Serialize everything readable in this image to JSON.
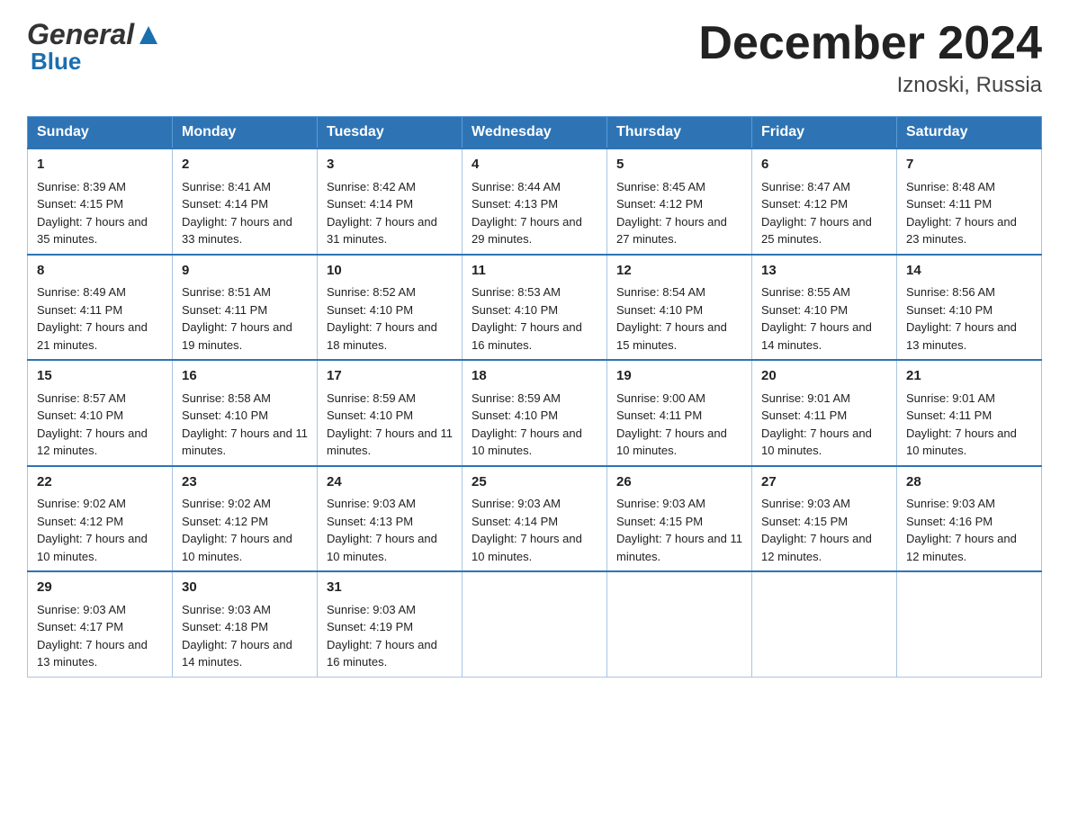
{
  "header": {
    "logo_general": "General",
    "logo_blue": "Blue",
    "title": "December 2024",
    "subtitle": "Iznoski, Russia"
  },
  "days_of_week": [
    "Sunday",
    "Monday",
    "Tuesday",
    "Wednesday",
    "Thursday",
    "Friday",
    "Saturday"
  ],
  "weeks": [
    [
      {
        "day": "1",
        "sunrise": "Sunrise: 8:39 AM",
        "sunset": "Sunset: 4:15 PM",
        "daylight": "Daylight: 7 hours and 35 minutes."
      },
      {
        "day": "2",
        "sunrise": "Sunrise: 8:41 AM",
        "sunset": "Sunset: 4:14 PM",
        "daylight": "Daylight: 7 hours and 33 minutes."
      },
      {
        "day": "3",
        "sunrise": "Sunrise: 8:42 AM",
        "sunset": "Sunset: 4:14 PM",
        "daylight": "Daylight: 7 hours and 31 minutes."
      },
      {
        "day": "4",
        "sunrise": "Sunrise: 8:44 AM",
        "sunset": "Sunset: 4:13 PM",
        "daylight": "Daylight: 7 hours and 29 minutes."
      },
      {
        "day": "5",
        "sunrise": "Sunrise: 8:45 AM",
        "sunset": "Sunset: 4:12 PM",
        "daylight": "Daylight: 7 hours and 27 minutes."
      },
      {
        "day": "6",
        "sunrise": "Sunrise: 8:47 AM",
        "sunset": "Sunset: 4:12 PM",
        "daylight": "Daylight: 7 hours and 25 minutes."
      },
      {
        "day": "7",
        "sunrise": "Sunrise: 8:48 AM",
        "sunset": "Sunset: 4:11 PM",
        "daylight": "Daylight: 7 hours and 23 minutes."
      }
    ],
    [
      {
        "day": "8",
        "sunrise": "Sunrise: 8:49 AM",
        "sunset": "Sunset: 4:11 PM",
        "daylight": "Daylight: 7 hours and 21 minutes."
      },
      {
        "day": "9",
        "sunrise": "Sunrise: 8:51 AM",
        "sunset": "Sunset: 4:11 PM",
        "daylight": "Daylight: 7 hours and 19 minutes."
      },
      {
        "day": "10",
        "sunrise": "Sunrise: 8:52 AM",
        "sunset": "Sunset: 4:10 PM",
        "daylight": "Daylight: 7 hours and 18 minutes."
      },
      {
        "day": "11",
        "sunrise": "Sunrise: 8:53 AM",
        "sunset": "Sunset: 4:10 PM",
        "daylight": "Daylight: 7 hours and 16 minutes."
      },
      {
        "day": "12",
        "sunrise": "Sunrise: 8:54 AM",
        "sunset": "Sunset: 4:10 PM",
        "daylight": "Daylight: 7 hours and 15 minutes."
      },
      {
        "day": "13",
        "sunrise": "Sunrise: 8:55 AM",
        "sunset": "Sunset: 4:10 PM",
        "daylight": "Daylight: 7 hours and 14 minutes."
      },
      {
        "day": "14",
        "sunrise": "Sunrise: 8:56 AM",
        "sunset": "Sunset: 4:10 PM",
        "daylight": "Daylight: 7 hours and 13 minutes."
      }
    ],
    [
      {
        "day": "15",
        "sunrise": "Sunrise: 8:57 AM",
        "sunset": "Sunset: 4:10 PM",
        "daylight": "Daylight: 7 hours and 12 minutes."
      },
      {
        "day": "16",
        "sunrise": "Sunrise: 8:58 AM",
        "sunset": "Sunset: 4:10 PM",
        "daylight": "Daylight: 7 hours and 11 minutes."
      },
      {
        "day": "17",
        "sunrise": "Sunrise: 8:59 AM",
        "sunset": "Sunset: 4:10 PM",
        "daylight": "Daylight: 7 hours and 11 minutes."
      },
      {
        "day": "18",
        "sunrise": "Sunrise: 8:59 AM",
        "sunset": "Sunset: 4:10 PM",
        "daylight": "Daylight: 7 hours and 10 minutes."
      },
      {
        "day": "19",
        "sunrise": "Sunrise: 9:00 AM",
        "sunset": "Sunset: 4:11 PM",
        "daylight": "Daylight: 7 hours and 10 minutes."
      },
      {
        "day": "20",
        "sunrise": "Sunrise: 9:01 AM",
        "sunset": "Sunset: 4:11 PM",
        "daylight": "Daylight: 7 hours and 10 minutes."
      },
      {
        "day": "21",
        "sunrise": "Sunrise: 9:01 AM",
        "sunset": "Sunset: 4:11 PM",
        "daylight": "Daylight: 7 hours and 10 minutes."
      }
    ],
    [
      {
        "day": "22",
        "sunrise": "Sunrise: 9:02 AM",
        "sunset": "Sunset: 4:12 PM",
        "daylight": "Daylight: 7 hours and 10 minutes."
      },
      {
        "day": "23",
        "sunrise": "Sunrise: 9:02 AM",
        "sunset": "Sunset: 4:12 PM",
        "daylight": "Daylight: 7 hours and 10 minutes."
      },
      {
        "day": "24",
        "sunrise": "Sunrise: 9:03 AM",
        "sunset": "Sunset: 4:13 PM",
        "daylight": "Daylight: 7 hours and 10 minutes."
      },
      {
        "day": "25",
        "sunrise": "Sunrise: 9:03 AM",
        "sunset": "Sunset: 4:14 PM",
        "daylight": "Daylight: 7 hours and 10 minutes."
      },
      {
        "day": "26",
        "sunrise": "Sunrise: 9:03 AM",
        "sunset": "Sunset: 4:15 PM",
        "daylight": "Daylight: 7 hours and 11 minutes."
      },
      {
        "day": "27",
        "sunrise": "Sunrise: 9:03 AM",
        "sunset": "Sunset: 4:15 PM",
        "daylight": "Daylight: 7 hours and 12 minutes."
      },
      {
        "day": "28",
        "sunrise": "Sunrise: 9:03 AM",
        "sunset": "Sunset: 4:16 PM",
        "daylight": "Daylight: 7 hours and 12 minutes."
      }
    ],
    [
      {
        "day": "29",
        "sunrise": "Sunrise: 9:03 AM",
        "sunset": "Sunset: 4:17 PM",
        "daylight": "Daylight: 7 hours and 13 minutes."
      },
      {
        "day": "30",
        "sunrise": "Sunrise: 9:03 AM",
        "sunset": "Sunset: 4:18 PM",
        "daylight": "Daylight: 7 hours and 14 minutes."
      },
      {
        "day": "31",
        "sunrise": "Sunrise: 9:03 AM",
        "sunset": "Sunset: 4:19 PM",
        "daylight": "Daylight: 7 hours and 16 minutes."
      },
      null,
      null,
      null,
      null
    ]
  ]
}
